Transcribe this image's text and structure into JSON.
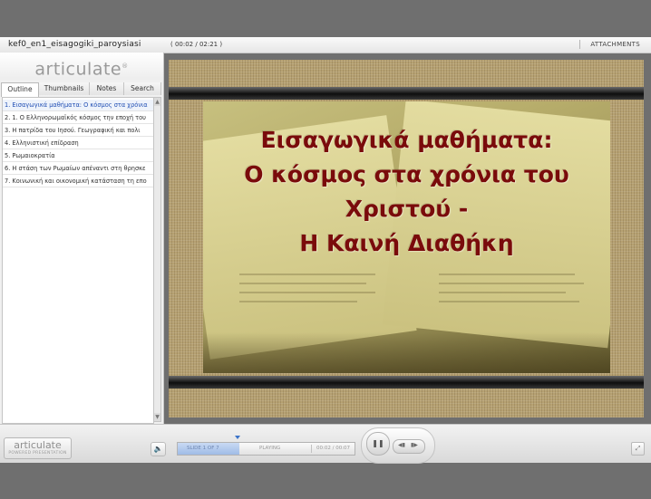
{
  "topbar": {
    "title": "kef0_en1_eisagogiki_paroysiasi",
    "time": "( 00:02 / 02:21 )",
    "attachments": "ATTACHMENTS"
  },
  "sidebar": {
    "logo": "articulate",
    "tabs": [
      {
        "label": "Outline",
        "active": true
      },
      {
        "label": "Thumbnails"
      },
      {
        "label": "Notes"
      },
      {
        "label": "Search"
      }
    ],
    "items": [
      {
        "label": "1. Εισαγωγικά μαθήματα: Ο κόσμος στα χρόνια",
        "active": true
      },
      {
        "label": "2. 1. Ο Ελληνορωμαϊκός κόσμος την εποχή του"
      },
      {
        "label": "3. Η πατρίδα του Ιησού. Γεωγραφική και πολι"
      },
      {
        "label": "4. Ελληνιστική επίδραση"
      },
      {
        "label": "5. Ρωμαιοκρατία"
      },
      {
        "label": "6. Η στάση των Ρωμαίων απέναντι στη θρησκε"
      },
      {
        "label": "7. Κοινωνική και οικονομική κατάσταση τη επο"
      }
    ]
  },
  "slide": {
    "title_lines": [
      "Εισαγωγικά μαθήματα:",
      "Ο κόσμος στα χρόνια του",
      "Χριστού -",
      "Η Καινή Διαθήκη"
    ]
  },
  "player": {
    "logo": "articulate",
    "logo_sub": "POWERED PRESENTATION",
    "slide_counter": "SLIDE 1 OF 7",
    "status": "PLAYING",
    "time": "00:02 / 00:07",
    "progress": 0.35
  },
  "colors": {
    "title": "#7a0b0b",
    "active_item": "#2250b5",
    "progress_fill": "#9fbbe6"
  },
  "icons": {
    "volume": "speaker-icon",
    "pause": "pause-icon",
    "prev": "previous-icon",
    "next": "next-icon",
    "fullscreen": "fullscreen-icon"
  }
}
